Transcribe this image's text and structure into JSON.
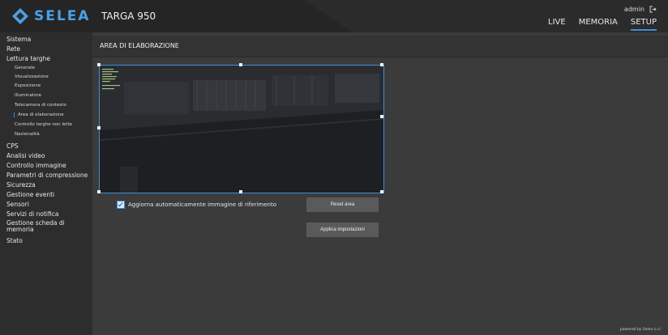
{
  "brand": {
    "logo_text": "SELEA",
    "model": "TARGA 950"
  },
  "header": {
    "user": "admin",
    "nav": [
      {
        "label": "LIVE",
        "active": false
      },
      {
        "label": "MEMORIA",
        "active": false
      },
      {
        "label": "SETUP",
        "active": true
      }
    ]
  },
  "sidebar": {
    "items": [
      {
        "label": "Sistema"
      },
      {
        "label": "Rete"
      },
      {
        "label": "Lettura targhe"
      },
      {
        "label": "CPS"
      },
      {
        "label": "Analisi video"
      },
      {
        "label": "Controllo immagine"
      },
      {
        "label": "Parametri di compressione"
      },
      {
        "label": "Sicurezza"
      },
      {
        "label": "Gestione eventi"
      },
      {
        "label": "Sensori"
      },
      {
        "label": "Servizi di notifica"
      },
      {
        "label": "Gestione scheda di memoria"
      },
      {
        "label": "Stato"
      }
    ],
    "subitems": [
      {
        "label": "Generale"
      },
      {
        "label": "Visualizzazione"
      },
      {
        "label": "Esposizione"
      },
      {
        "label": "Illuminatore"
      },
      {
        "label": "Telecamera di contesto"
      },
      {
        "label": "Area di elaborazione",
        "active": true
      },
      {
        "label": "Controllo targhe non lette"
      },
      {
        "label": "Nazionalità"
      }
    ]
  },
  "main": {
    "title": "AREA DI ELABORAZIONE",
    "checkbox_label": "Aggiorna automaticamente immagine di riferimento",
    "checkbox_checked": true,
    "reset_button": "Reset area",
    "apply_button": "Applica impostazioni"
  },
  "footer": {
    "powered": "powered by Selea s.r.l."
  },
  "colors": {
    "accent": "#3d8fdb",
    "brand": "#4aa0e6",
    "background": "#3b3b3b",
    "sidebar": "#2d2d2d"
  }
}
